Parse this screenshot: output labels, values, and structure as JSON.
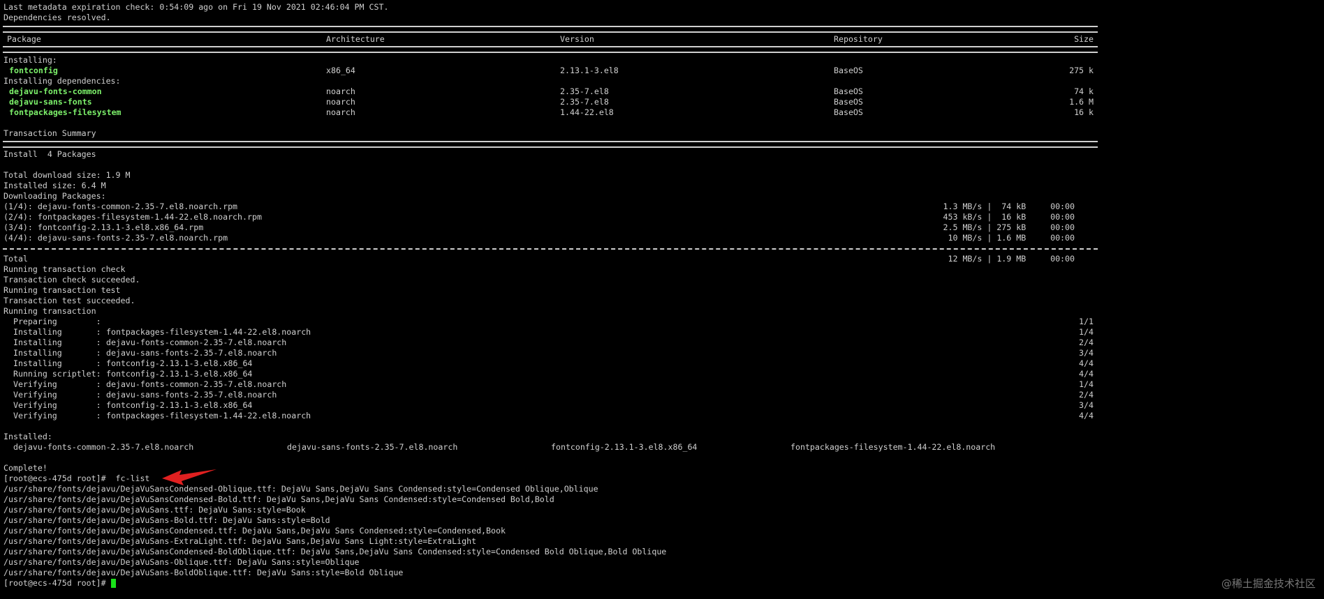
{
  "head": [
    "Last metadata expiration check: 0:54:09 ago on Fri 19 Nov 2021 02:46:04 PM CST.",
    "Dependencies resolved."
  ],
  "table": {
    "headers": [
      "Package",
      "Architecture",
      "Version",
      "Repository",
      "Size"
    ],
    "installing_label": "Installing:",
    "deps_label": "Installing dependencies:",
    "main_pkg": {
      "name": "fontconfig",
      "arch": "x86_64",
      "version": "2.13.1-3.el8",
      "repo": "BaseOS",
      "size": "275 k"
    },
    "deps": [
      {
        "name": "dejavu-fonts-common",
        "arch": "noarch",
        "version": "2.35-7.el8",
        "repo": "BaseOS",
        "size": "74 k"
      },
      {
        "name": "dejavu-sans-fonts",
        "arch": "noarch",
        "version": "2.35-7.el8",
        "repo": "BaseOS",
        "size": "1.6 M"
      },
      {
        "name": "fontpackages-filesystem",
        "arch": "noarch",
        "version": "1.44-22.el8",
        "repo": "BaseOS",
        "size": "16 k"
      }
    ]
  },
  "summary": {
    "title": "Transaction Summary",
    "install": "Install  4 Packages",
    "total_download": "Total download size: 1.9 M",
    "installed_size": "Installed size: 6.4 M",
    "downloading": "Downloading Packages:"
  },
  "downloads": [
    {
      "file": "(1/4): dejavu-fonts-common-2.35-7.el8.noarch.rpm",
      "stats": "1.3 MB/s |  74 kB     00:00"
    },
    {
      "file": "(2/4): fontpackages-filesystem-1.44-22.el8.noarch.rpm",
      "stats": "453 kB/s |  16 kB     00:00"
    },
    {
      "file": "(3/4): fontconfig-2.13.1-3.el8.x86_64.rpm",
      "stats": "2.5 MB/s | 275 kB     00:00"
    },
    {
      "file": "(4/4): dejavu-sans-fonts-2.35-7.el8.noarch.rpm",
      "stats": "10 MB/s | 1.6 MB     00:00"
    }
  ],
  "total": {
    "label": "Total",
    "stats": "12 MB/s | 1.9 MB     00:00"
  },
  "tx_lines": [
    "Running transaction check",
    "Transaction check succeeded.",
    "Running transaction test",
    "Transaction test succeeded.",
    "Running transaction"
  ],
  "steps": [
    {
      "action": "  Preparing        :",
      "pkg": "",
      "n": "1/1"
    },
    {
      "action": "  Installing       :",
      "pkg": "fontpackages-filesystem-1.44-22.el8.noarch",
      "n": "1/4"
    },
    {
      "action": "  Installing       :",
      "pkg": "dejavu-fonts-common-2.35-7.el8.noarch",
      "n": "2/4"
    },
    {
      "action": "  Installing       :",
      "pkg": "dejavu-sans-fonts-2.35-7.el8.noarch",
      "n": "3/4"
    },
    {
      "action": "  Installing       :",
      "pkg": "fontconfig-2.13.1-3.el8.x86_64",
      "n": "4/4"
    },
    {
      "action": "  Running scriptlet:",
      "pkg": "fontconfig-2.13.1-3.el8.x86_64",
      "n": "4/4"
    },
    {
      "action": "  Verifying        :",
      "pkg": "dejavu-fonts-common-2.35-7.el8.noarch",
      "n": "1/4"
    },
    {
      "action": "  Verifying        :",
      "pkg": "dejavu-sans-fonts-2.35-7.el8.noarch",
      "n": "2/4"
    },
    {
      "action": "  Verifying        :",
      "pkg": "fontconfig-2.13.1-3.el8.x86_64",
      "n": "3/4"
    },
    {
      "action": "  Verifying        :",
      "pkg": "fontpackages-filesystem-1.44-22.el8.noarch",
      "n": "4/4"
    }
  ],
  "installed": {
    "label": "Installed:",
    "items": [
      "  dejavu-fonts-common-2.35-7.el8.noarch",
      "dejavu-sans-fonts-2.35-7.el8.noarch",
      "fontconfig-2.13.1-3.el8.x86_64",
      "fontpackages-filesystem-1.44-22.el8.noarch"
    ]
  },
  "complete": "Complete!",
  "prompt_cmd": "[root@ecs-475d root]#  fc-list",
  "fc_list": [
    "/usr/share/fonts/dejavu/DejaVuSansCondensed-Oblique.ttf: DejaVu Sans,DejaVu Sans Condensed:style=Condensed Oblique,Oblique",
    "/usr/share/fonts/dejavu/DejaVuSansCondensed-Bold.ttf: DejaVu Sans,DejaVu Sans Condensed:style=Condensed Bold,Bold",
    "/usr/share/fonts/dejavu/DejaVuSans.ttf: DejaVu Sans:style=Book",
    "/usr/share/fonts/dejavu/DejaVuSans-Bold.ttf: DejaVu Sans:style=Bold",
    "/usr/share/fonts/dejavu/DejaVuSansCondensed.ttf: DejaVu Sans,DejaVu Sans Condensed:style=Condensed,Book",
    "/usr/share/fonts/dejavu/DejaVuSans-ExtraLight.ttf: DejaVu Sans,DejaVu Sans Light:style=ExtraLight",
    "/usr/share/fonts/dejavu/DejaVuSansCondensed-BoldOblique.ttf: DejaVu Sans,DejaVu Sans Condensed:style=Condensed Bold Oblique,Bold Oblique",
    "/usr/share/fonts/dejavu/DejaVuSans-Oblique.ttf: DejaVu Sans:style=Oblique",
    "/usr/share/fonts/dejavu/DejaVuSans-BoldOblique.ttf: DejaVu Sans:style=Bold Oblique"
  ],
  "final_prompt": "[root@ecs-475d root]#",
  "watermark": "@稀土掘金技术社区",
  "colors": {
    "background": "#000000",
    "text": "#d0d0d0",
    "package_highlight": "#7cf06a",
    "arrow": "#e02020",
    "cursor": "#19e219"
  }
}
